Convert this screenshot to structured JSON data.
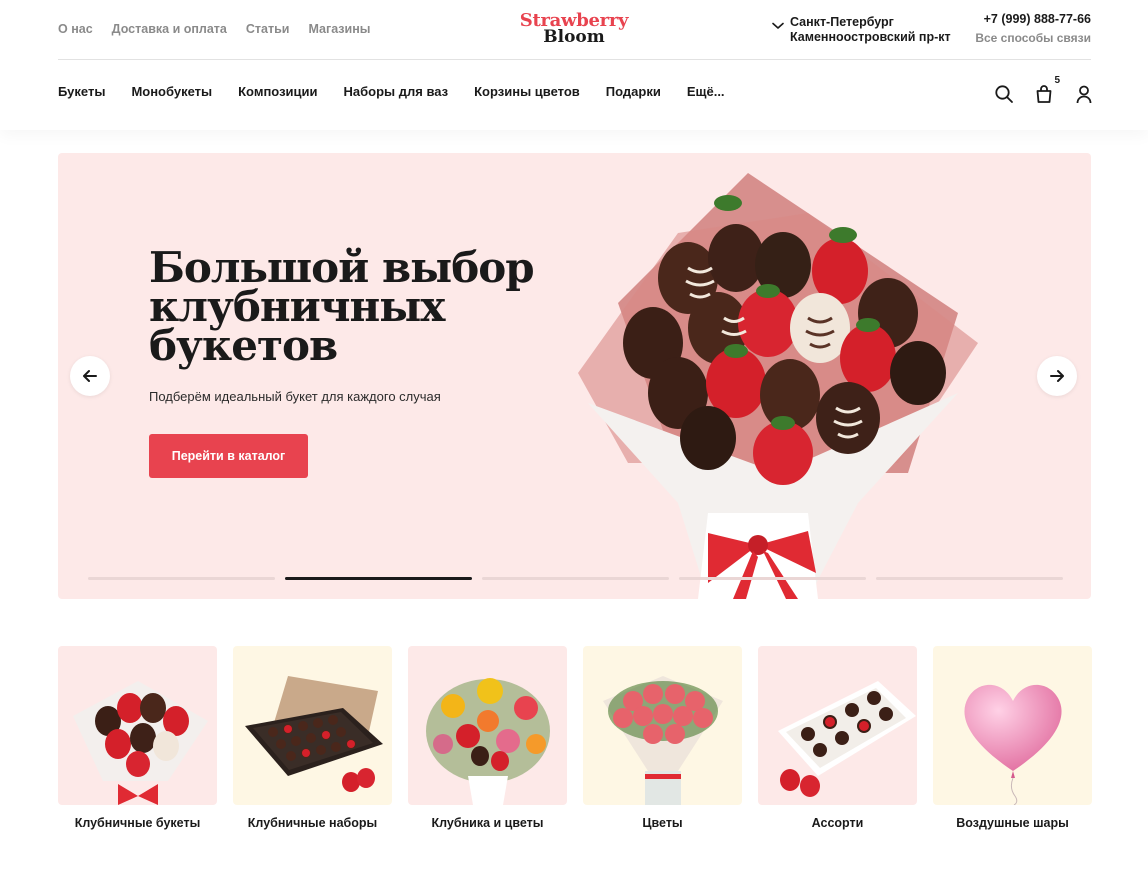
{
  "header": {
    "top_links": [
      "О нас",
      "Доставка и оплата",
      "Статьи",
      "Магазины"
    ],
    "logo": {
      "line1": "Strawberry",
      "line2": "Bloom"
    },
    "location": {
      "city": "Санкт-Петербург",
      "address": "Каменноостровский пр-кт"
    },
    "contacts": {
      "phone": "+7 (999) 888-77-66",
      "all_ways": "Все способы связи"
    },
    "nav": [
      "Букеты",
      "Монобукеты",
      "Композиции",
      "Наборы для ваз",
      "Корзины цветов",
      "Подарки",
      "Ещё..."
    ],
    "cart_count": "5",
    "icons": [
      "search-icon",
      "cart-icon",
      "user-icon"
    ]
  },
  "hero": {
    "title_lines": [
      "Большой выбор",
      "клубничных",
      "букетов"
    ],
    "subtitle": "Подберём идеальный букет для каждого случая",
    "cta": "Перейти в каталог",
    "slides_total": 5,
    "active_slide": 2
  },
  "categories": [
    {
      "label": "Клубничные букеты"
    },
    {
      "label": "Клубничные наборы"
    },
    {
      "label": "Клубника и цветы"
    },
    {
      "label": "Цветы"
    },
    {
      "label": "Ассорти"
    },
    {
      "label": "Воздушные шары"
    }
  ],
  "colors": {
    "accent": "#e8434f",
    "hero_bg": "#fde9e8",
    "cream": "#fef7e4",
    "muted": "#8a8a8a"
  }
}
